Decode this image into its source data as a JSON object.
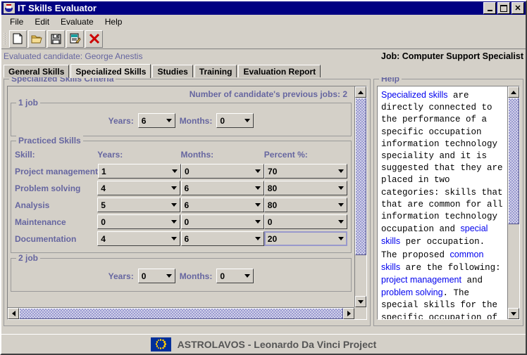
{
  "window": {
    "title": "IT Skills Evaluator",
    "icon": "app-icon",
    "minimize_label": "",
    "maximize_label": "",
    "close_label": "✕"
  },
  "menu": {
    "items": [
      {
        "label": "File"
      },
      {
        "label": "Edit"
      },
      {
        "label": "Evaluate"
      },
      {
        "label": "Help"
      }
    ]
  },
  "toolbar": {
    "buttons": [
      {
        "icon": "new-document-icon",
        "label": ""
      },
      {
        "icon": "open-folder-icon",
        "label": ""
      },
      {
        "icon": "save-floppy-icon",
        "label": ""
      },
      {
        "icon": "evaluate-form-icon",
        "label": ""
      },
      {
        "icon": "delete-x-icon",
        "label": ""
      }
    ]
  },
  "header": {
    "candidate": "Evaluated candidate: George Anestis",
    "job": "Job: Computer Support Specialist"
  },
  "tabs": [
    {
      "label": "General Skills",
      "active": false
    },
    {
      "label": "Specialized Skills",
      "active": true
    },
    {
      "label": "Studies",
      "active": false
    },
    {
      "label": "Training",
      "active": false
    },
    {
      "label": "Evaluation Report",
      "active": false
    }
  ],
  "criteria": {
    "legend": "Specialized Skills Criteria",
    "jobs_count_text": "Number of candidate's previous jobs: 2",
    "job1": {
      "legend": "1 job",
      "years_label": "Years:",
      "years_value": "6",
      "months_label": "Months:",
      "months_value": "0"
    },
    "practiced": {
      "legend": "Practiced Skills",
      "columns": {
        "skill": "Skill:",
        "years": "Years:",
        "months": "Months:",
        "percent": "Percent %:"
      },
      "rows": [
        {
          "skill": "Project management",
          "years": "1",
          "months": "0",
          "percent": "70",
          "focused": false
        },
        {
          "skill": "Problem solving",
          "years": "4",
          "months": "6",
          "percent": "80",
          "focused": false
        },
        {
          "skill": "Analysis",
          "years": "5",
          "months": "6",
          "percent": "80",
          "focused": false
        },
        {
          "skill": "Maintenance",
          "years": "0",
          "months": "0",
          "percent": "0",
          "focused": false
        },
        {
          "skill": "Documentation",
          "years": "4",
          "months": "6",
          "percent": "20",
          "focused": true
        }
      ]
    },
    "job2": {
      "legend": "2 job",
      "years_label": "Years:",
      "years_value": "0",
      "months_label": "Months:",
      "months_value": "0"
    }
  },
  "help": {
    "legend": "Help",
    "body_segments": [
      {
        "text": "Specialized skills",
        "link": true
      },
      {
        "text": " are directly connected to the performance of a specific occupation information technology speciality and it is suggested that they are placed in two categories: skills that that are common for all information technology occupation and ",
        "link": false
      },
      {
        "text": "special skills",
        "link": true
      },
      {
        "text": " per occupation. The proposed ",
        "link": false
      },
      {
        "text": "common skills",
        "link": true
      },
      {
        "text": " are the following: ",
        "link": false
      },
      {
        "text": "project management",
        "link": true
      },
      {
        "text": " and ",
        "link": false
      },
      {
        "text": "problem solving",
        "link": true
      },
      {
        "text": ". The special skills for the specific occupation of Computer",
        "link": false
      }
    ]
  },
  "footer": {
    "text": "ASTROLAVOS - Leonardo Da Vinci Project",
    "flag": "eu-flag-icon"
  },
  "colors": {
    "titlebar": "#000082",
    "face": "#d4d0c8",
    "label_purple": "#6666a0",
    "link_blue": "#0000ee",
    "scroll_thumb": "#9a9ad0"
  }
}
